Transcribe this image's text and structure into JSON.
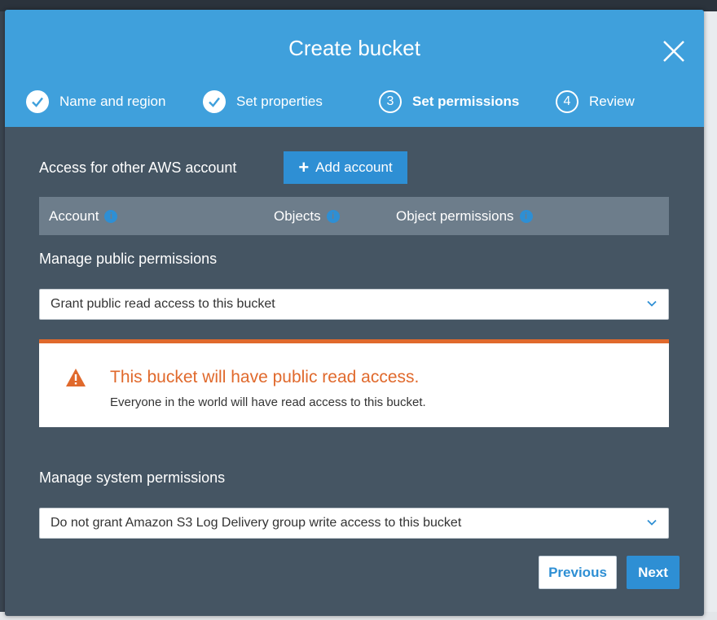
{
  "modal": {
    "title": "Create bucket",
    "steps": [
      {
        "label": "Name and region",
        "status": "done",
        "number": ""
      },
      {
        "label": "Set properties",
        "status": "done",
        "number": ""
      },
      {
        "label": "Set permissions",
        "status": "active",
        "number": "3"
      },
      {
        "label": "Review",
        "status": "pending",
        "number": "4"
      }
    ]
  },
  "access": {
    "label": "Access for other AWS account",
    "add_button": "Add account",
    "columns": [
      "Account",
      "Objects",
      "Object permissions"
    ]
  },
  "public_permissions": {
    "label": "Manage public permissions",
    "selected": "Grant public read access to this bucket"
  },
  "alert": {
    "title": "This bucket will have public read access.",
    "body": "Everyone in the world will have read access to this bucket."
  },
  "system_permissions": {
    "label": "Manage system permissions",
    "selected": "Do not grant Amazon S3 Log Delivery group write access to this bucket"
  },
  "footer": {
    "previous_label": "Previous",
    "next_label": "Next"
  },
  "colors": {
    "header": "#3fa0dc",
    "body": "#455563",
    "primary_button": "#2e8fd4",
    "warning": "#e0692c"
  }
}
